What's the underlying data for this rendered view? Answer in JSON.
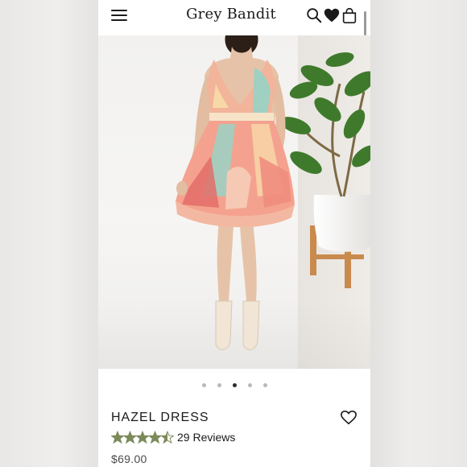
{
  "header": {
    "brand": "Grey Bandit",
    "icons": [
      "hamburger-menu-icon",
      "search-icon",
      "heart-icon",
      "shopping-bag-icon"
    ]
  },
  "gallery": {
    "image": "product-photo",
    "slide_count": 5,
    "active_slide": 3
  },
  "product": {
    "name": "HAZEL DRESS",
    "rating": 4.5,
    "reviews_label": "29 Reviews",
    "price": "$69.00"
  },
  "colors": {
    "star": "#7c8a5a",
    "text": "#1a1a1a",
    "price": "#4b4b4b"
  }
}
